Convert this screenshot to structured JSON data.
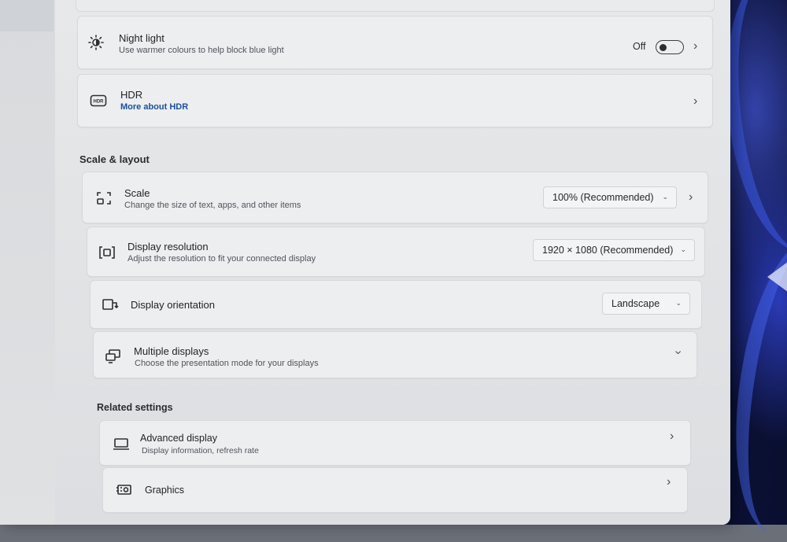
{
  "night_light": {
    "icon": "brightness-sun-icon",
    "title": "Night light",
    "subtitle": "Use warmer colours to help block blue light",
    "state_label": "Off",
    "toggle_on": false
  },
  "hdr": {
    "icon": "hdr-icon",
    "title": "HDR",
    "link": "More about HDR"
  },
  "scale_layout": {
    "heading": "Scale & layout",
    "scale": {
      "icon": "scale-icon",
      "title": "Scale",
      "subtitle": "Change the size of text, apps, and other items",
      "value": "100% (Recommended)"
    },
    "resolution": {
      "icon": "resolution-icon",
      "title": "Display resolution",
      "subtitle": "Adjust the resolution to fit your connected display",
      "value": "1920 × 1080 (Recommended)"
    },
    "orientation": {
      "icon": "orientation-icon",
      "title": "Display orientation",
      "value": "Landscape"
    },
    "multiple": {
      "icon": "multiple-displays-icon",
      "title": "Multiple displays",
      "subtitle": "Choose the presentation mode for your displays"
    }
  },
  "related": {
    "heading": "Related settings",
    "advanced": {
      "icon": "monitor-icon",
      "title": "Advanced display",
      "subtitle": "Display information, refresh rate"
    },
    "graphics": {
      "icon": "graphics-icon",
      "title": "Graphics"
    }
  }
}
